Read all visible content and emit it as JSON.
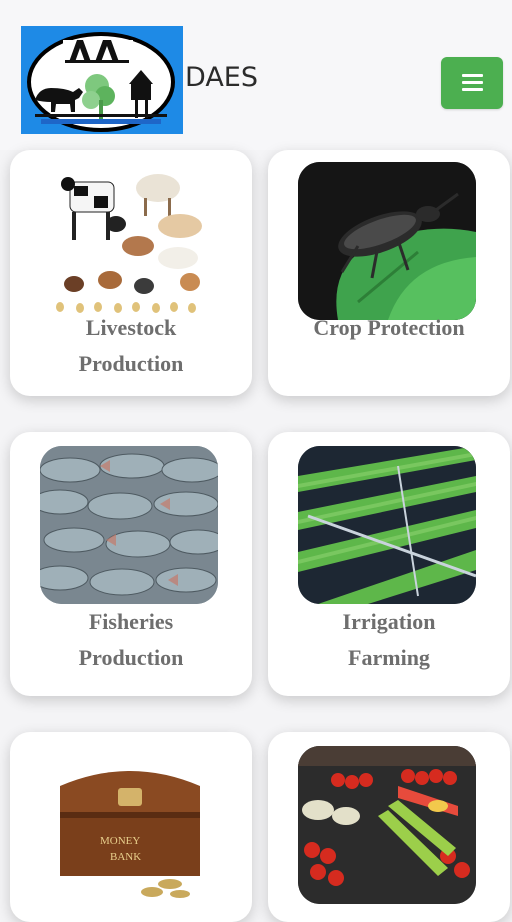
{
  "header": {
    "brand": "DAES",
    "logo_alt": "DAES logo",
    "menu_icon": "hamburger-icon"
  },
  "colors": {
    "menu_button": "#4caf50",
    "logo_background": "#1e8ae6",
    "label_text": "#6e6e6e"
  },
  "cards": [
    {
      "label": "Livestock\nProduction",
      "icon": "livestock-image"
    },
    {
      "label": "Crop Protection",
      "icon": "beetle-image"
    },
    {
      "label": "Fisheries\nProduction",
      "icon": "fish-image"
    },
    {
      "label": "Irrigation\nFarming",
      "icon": "irrigation-field-image"
    },
    {
      "label": "",
      "icon": "money-bank-image"
    },
    {
      "label": "",
      "icon": "vegetable-market-image"
    }
  ]
}
